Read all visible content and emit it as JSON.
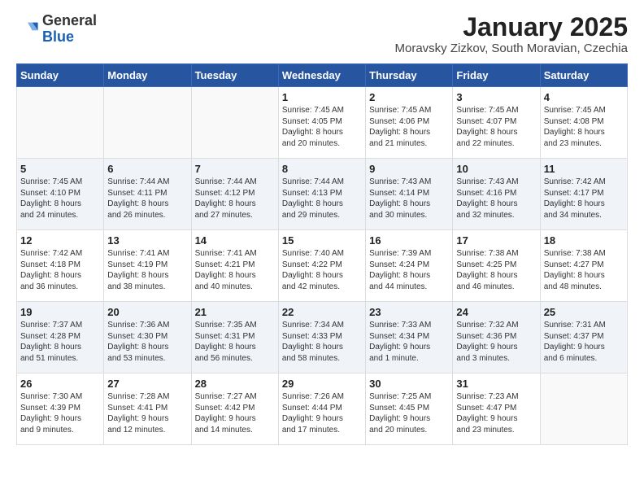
{
  "header": {
    "logo_general": "General",
    "logo_blue": "Blue",
    "month": "January 2025",
    "location": "Moravsky Zizkov, South Moravian, Czechia"
  },
  "days_of_week": [
    "Sunday",
    "Monday",
    "Tuesday",
    "Wednesday",
    "Thursday",
    "Friday",
    "Saturday"
  ],
  "weeks": [
    [
      {
        "day": "",
        "info": ""
      },
      {
        "day": "",
        "info": ""
      },
      {
        "day": "",
        "info": ""
      },
      {
        "day": "1",
        "info": "Sunrise: 7:45 AM\nSunset: 4:05 PM\nDaylight: 8 hours\nand 20 minutes."
      },
      {
        "day": "2",
        "info": "Sunrise: 7:45 AM\nSunset: 4:06 PM\nDaylight: 8 hours\nand 21 minutes."
      },
      {
        "day": "3",
        "info": "Sunrise: 7:45 AM\nSunset: 4:07 PM\nDaylight: 8 hours\nand 22 minutes."
      },
      {
        "day": "4",
        "info": "Sunrise: 7:45 AM\nSunset: 4:08 PM\nDaylight: 8 hours\nand 23 minutes."
      }
    ],
    [
      {
        "day": "5",
        "info": "Sunrise: 7:45 AM\nSunset: 4:10 PM\nDaylight: 8 hours\nand 24 minutes."
      },
      {
        "day": "6",
        "info": "Sunrise: 7:44 AM\nSunset: 4:11 PM\nDaylight: 8 hours\nand 26 minutes."
      },
      {
        "day": "7",
        "info": "Sunrise: 7:44 AM\nSunset: 4:12 PM\nDaylight: 8 hours\nand 27 minutes."
      },
      {
        "day": "8",
        "info": "Sunrise: 7:44 AM\nSunset: 4:13 PM\nDaylight: 8 hours\nand 29 minutes."
      },
      {
        "day": "9",
        "info": "Sunrise: 7:43 AM\nSunset: 4:14 PM\nDaylight: 8 hours\nand 30 minutes."
      },
      {
        "day": "10",
        "info": "Sunrise: 7:43 AM\nSunset: 4:16 PM\nDaylight: 8 hours\nand 32 minutes."
      },
      {
        "day": "11",
        "info": "Sunrise: 7:42 AM\nSunset: 4:17 PM\nDaylight: 8 hours\nand 34 minutes."
      }
    ],
    [
      {
        "day": "12",
        "info": "Sunrise: 7:42 AM\nSunset: 4:18 PM\nDaylight: 8 hours\nand 36 minutes."
      },
      {
        "day": "13",
        "info": "Sunrise: 7:41 AM\nSunset: 4:19 PM\nDaylight: 8 hours\nand 38 minutes."
      },
      {
        "day": "14",
        "info": "Sunrise: 7:41 AM\nSunset: 4:21 PM\nDaylight: 8 hours\nand 40 minutes."
      },
      {
        "day": "15",
        "info": "Sunrise: 7:40 AM\nSunset: 4:22 PM\nDaylight: 8 hours\nand 42 minutes."
      },
      {
        "day": "16",
        "info": "Sunrise: 7:39 AM\nSunset: 4:24 PM\nDaylight: 8 hours\nand 44 minutes."
      },
      {
        "day": "17",
        "info": "Sunrise: 7:38 AM\nSunset: 4:25 PM\nDaylight: 8 hours\nand 46 minutes."
      },
      {
        "day": "18",
        "info": "Sunrise: 7:38 AM\nSunset: 4:27 PM\nDaylight: 8 hours\nand 48 minutes."
      }
    ],
    [
      {
        "day": "19",
        "info": "Sunrise: 7:37 AM\nSunset: 4:28 PM\nDaylight: 8 hours\nand 51 minutes."
      },
      {
        "day": "20",
        "info": "Sunrise: 7:36 AM\nSunset: 4:30 PM\nDaylight: 8 hours\nand 53 minutes."
      },
      {
        "day": "21",
        "info": "Sunrise: 7:35 AM\nSunset: 4:31 PM\nDaylight: 8 hours\nand 56 minutes."
      },
      {
        "day": "22",
        "info": "Sunrise: 7:34 AM\nSunset: 4:33 PM\nDaylight: 8 hours\nand 58 minutes."
      },
      {
        "day": "23",
        "info": "Sunrise: 7:33 AM\nSunset: 4:34 PM\nDaylight: 9 hours\nand 1 minute."
      },
      {
        "day": "24",
        "info": "Sunrise: 7:32 AM\nSunset: 4:36 PM\nDaylight: 9 hours\nand 3 minutes."
      },
      {
        "day": "25",
        "info": "Sunrise: 7:31 AM\nSunset: 4:37 PM\nDaylight: 9 hours\nand 6 minutes."
      }
    ],
    [
      {
        "day": "26",
        "info": "Sunrise: 7:30 AM\nSunset: 4:39 PM\nDaylight: 9 hours\nand 9 minutes."
      },
      {
        "day": "27",
        "info": "Sunrise: 7:28 AM\nSunset: 4:41 PM\nDaylight: 9 hours\nand 12 minutes."
      },
      {
        "day": "28",
        "info": "Sunrise: 7:27 AM\nSunset: 4:42 PM\nDaylight: 9 hours\nand 14 minutes."
      },
      {
        "day": "29",
        "info": "Sunrise: 7:26 AM\nSunset: 4:44 PM\nDaylight: 9 hours\nand 17 minutes."
      },
      {
        "day": "30",
        "info": "Sunrise: 7:25 AM\nSunset: 4:45 PM\nDaylight: 9 hours\nand 20 minutes."
      },
      {
        "day": "31",
        "info": "Sunrise: 7:23 AM\nSunset: 4:47 PM\nDaylight: 9 hours\nand 23 minutes."
      },
      {
        "day": "",
        "info": ""
      }
    ]
  ]
}
